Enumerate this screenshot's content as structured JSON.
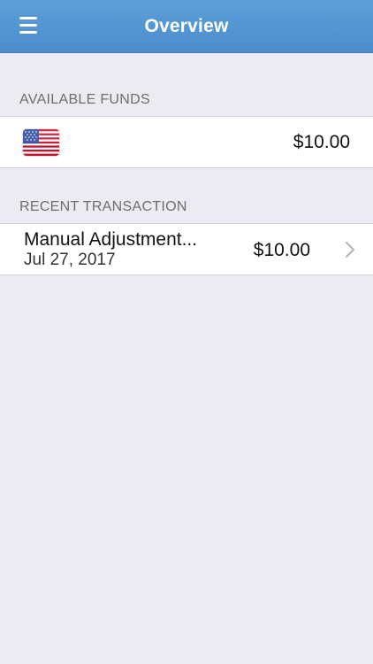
{
  "header": {
    "title": "Overview",
    "menu_icon": "hamburger-menu-icon"
  },
  "available_funds": {
    "section_label": "AVAILABLE FUNDS",
    "currency_icon": "us-flag-icon",
    "amount": "$10.00"
  },
  "recent_transaction": {
    "section_label": "RECENT TRANSACTION",
    "items": [
      {
        "title": "Manual Adjustment...",
        "date": "Jul 27, 2017",
        "amount": "$10.00",
        "icon": "chevron-right-icon"
      }
    ]
  },
  "colors": {
    "navbar": "#4f92d0",
    "background": "#ebebf1",
    "cell": "#ffffff",
    "section_text": "#6d6d72"
  }
}
